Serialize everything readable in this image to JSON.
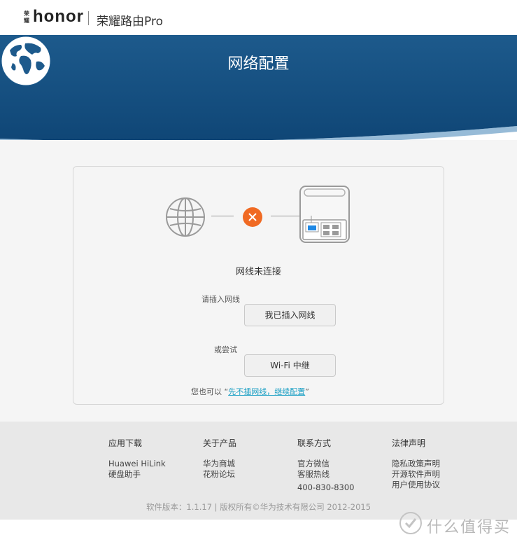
{
  "header": {
    "brand_mark": "荣耀",
    "brand_logo": "honor",
    "product_name": "荣耀路由Pro"
  },
  "hero": {
    "title": "网络配置"
  },
  "status": {
    "message": "网线未连接"
  },
  "actions": {
    "plug_prompt": "请插入网线",
    "plugged_button": "我已插入网线",
    "try_prompt": "或尝试",
    "wifi_button": "Wi-Fi 中继",
    "alt_prefix": "您也可以 “",
    "alt_link": "先不插网线，继续配置",
    "alt_suffix": "”"
  },
  "footer": {
    "columns": [
      {
        "heading": "应用下载",
        "items": [
          "Huawei HiLink",
          "硬盘助手"
        ]
      },
      {
        "heading": "关于产品",
        "items": [
          "华为商城",
          "花粉论坛"
        ]
      },
      {
        "heading": "联系方式",
        "items": [
          "官方微信",
          "客服热线",
          "400-830-8300"
        ]
      },
      {
        "heading": "法律声明",
        "items": [
          "隐私政策声明",
          "开源软件声明",
          "用户使用协议"
        ]
      }
    ],
    "copyright": "软件版本：1.1.17  |  版权所有©华为技术有限公司 2012-2015"
  },
  "watermark": {
    "text": "什么值得买"
  },
  "colors": {
    "hero_blue": "#1f5f93",
    "hero_dark": "#144c7d",
    "error_orange": "#f06a23",
    "link_blue": "#1a9fc4",
    "port_blue": "#1e88e5"
  }
}
